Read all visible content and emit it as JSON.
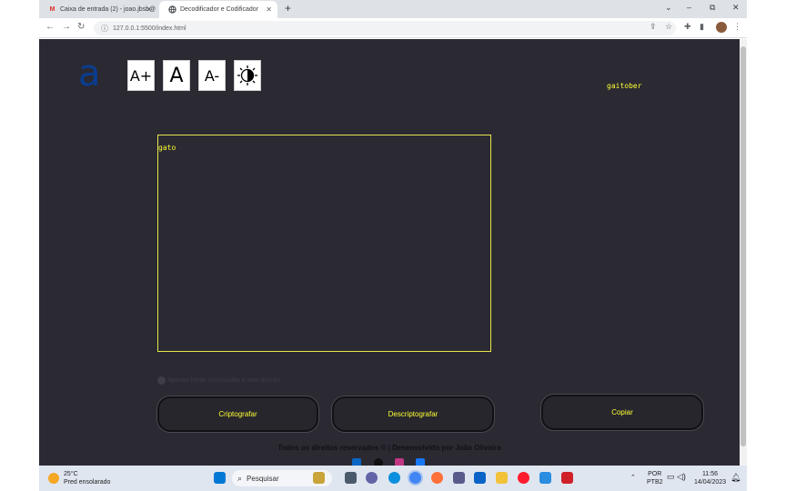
{
  "browser": {
    "tabs": [
      {
        "title": "Caixa de entrada (2) - joao.jbsb@",
        "favicon": "gmail-icon",
        "active": false
      },
      {
        "title": "Decodificador e Codificador",
        "favicon": "globe-icon",
        "active": true
      }
    ],
    "new_tab": "+",
    "address": "127.0.0.1:5500/index.html"
  },
  "page": {
    "logo_glyph": "a",
    "font_increase": "A+",
    "font_normal": "A",
    "font_decrease": "A-",
    "username": "gaitober",
    "input_text": "gato",
    "hint": "Apenas letras minúsculas e sem acento.",
    "encrypt_button": "Criptografar",
    "decrypt_button": "Descriptografar",
    "copy_button": "Copiar",
    "footer": "Todos os direitos reservados © | Desenvolvido por João Oliveira",
    "accent_color": "#ffff33",
    "background_color": "#2b2a33"
  },
  "taskbar": {
    "temperature": "25°C",
    "weather": "Pred ensolarado",
    "search_placeholder": "Pesquisar",
    "language": "POR",
    "layout": "PTB2",
    "time": "11:56",
    "date": "14/04/2023"
  }
}
